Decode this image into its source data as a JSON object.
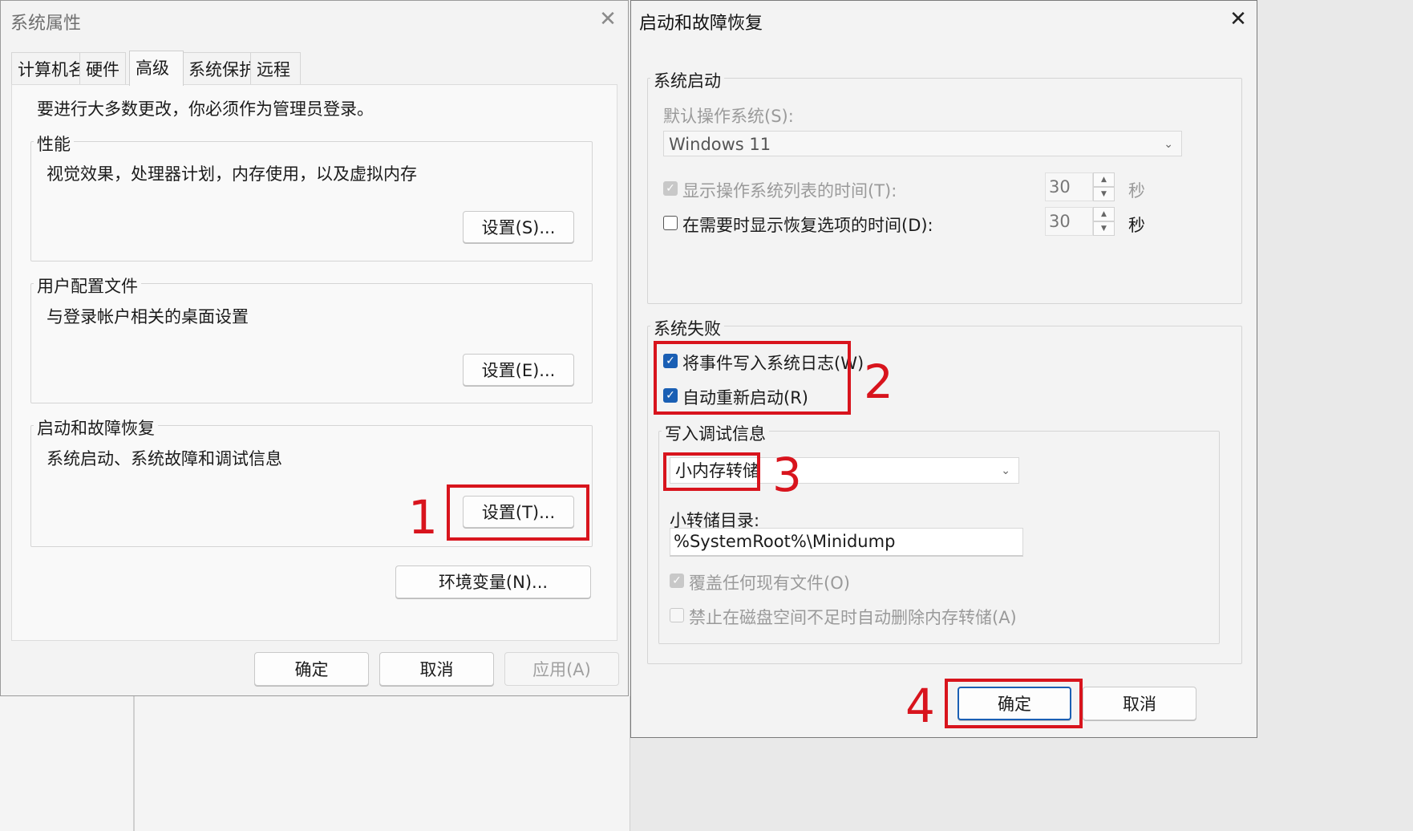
{
  "left_dialog": {
    "title": "系统属性",
    "close_glyph": "✕",
    "tabs": [
      "计算机名",
      "硬件",
      "高级",
      "系统保护",
      "远程"
    ],
    "selected_tab": "高级",
    "admin_note": "要进行大多数更改，你必须作为管理员登录。",
    "performance": {
      "legend": "性能",
      "desc": "视觉效果，处理器计划，内存使用，以及虚拟内存",
      "button": "设置(S)..."
    },
    "user_profiles": {
      "legend": "用户配置文件",
      "desc": "与登录帐户相关的桌面设置",
      "button": "设置(E)..."
    },
    "startup_recovery": {
      "legend": "启动和故障恢复",
      "desc": "系统启动、系统故障和调试信息",
      "button": "设置(T)..."
    },
    "env_button": "环境变量(N)...",
    "ok": "确定",
    "cancel": "取消",
    "apply": "应用(A)"
  },
  "right_dialog": {
    "title": "启动和故障恢复",
    "close_glyph": "✕",
    "system_startup": {
      "legend": "系统启动",
      "default_os_label": "默认操作系统(S):",
      "default_os_value": "Windows 11",
      "show_os_list": {
        "label": "显示操作系统列表的时间(T):",
        "value": "30",
        "unit": "秒",
        "checked": true,
        "disabled": true
      },
      "show_recovery": {
        "label": "在需要时显示恢复选项的时间(D):",
        "value": "30",
        "unit": "秒",
        "checked": false,
        "disabled": false
      }
    },
    "system_failure": {
      "legend": "系统失败",
      "write_event": {
        "label": "将事件写入系统日志(W)",
        "checked": true
      },
      "auto_restart": {
        "label": "自动重新启动(R)",
        "checked": true
      },
      "debug": {
        "legend": "写入调试信息",
        "dump_type": "小内存转储",
        "dump_dir_label": "小转储目录:",
        "dump_dir_value": "%SystemRoot%\\Minidump",
        "overwrite": {
          "label": "覆盖任何现有文件(O)",
          "checked": true,
          "disabled": true
        },
        "disable_auto_delete": {
          "label": "禁止在磁盘空间不足时自动删除内存转储(A)",
          "checked": false,
          "disabled": true
        }
      }
    },
    "ok": "确定",
    "cancel": "取消"
  },
  "annotations": [
    "1",
    "2",
    "3",
    "4"
  ],
  "colors": {
    "highlight_red": "#d8141d",
    "checkbox_blue": "#1a5fb4"
  }
}
